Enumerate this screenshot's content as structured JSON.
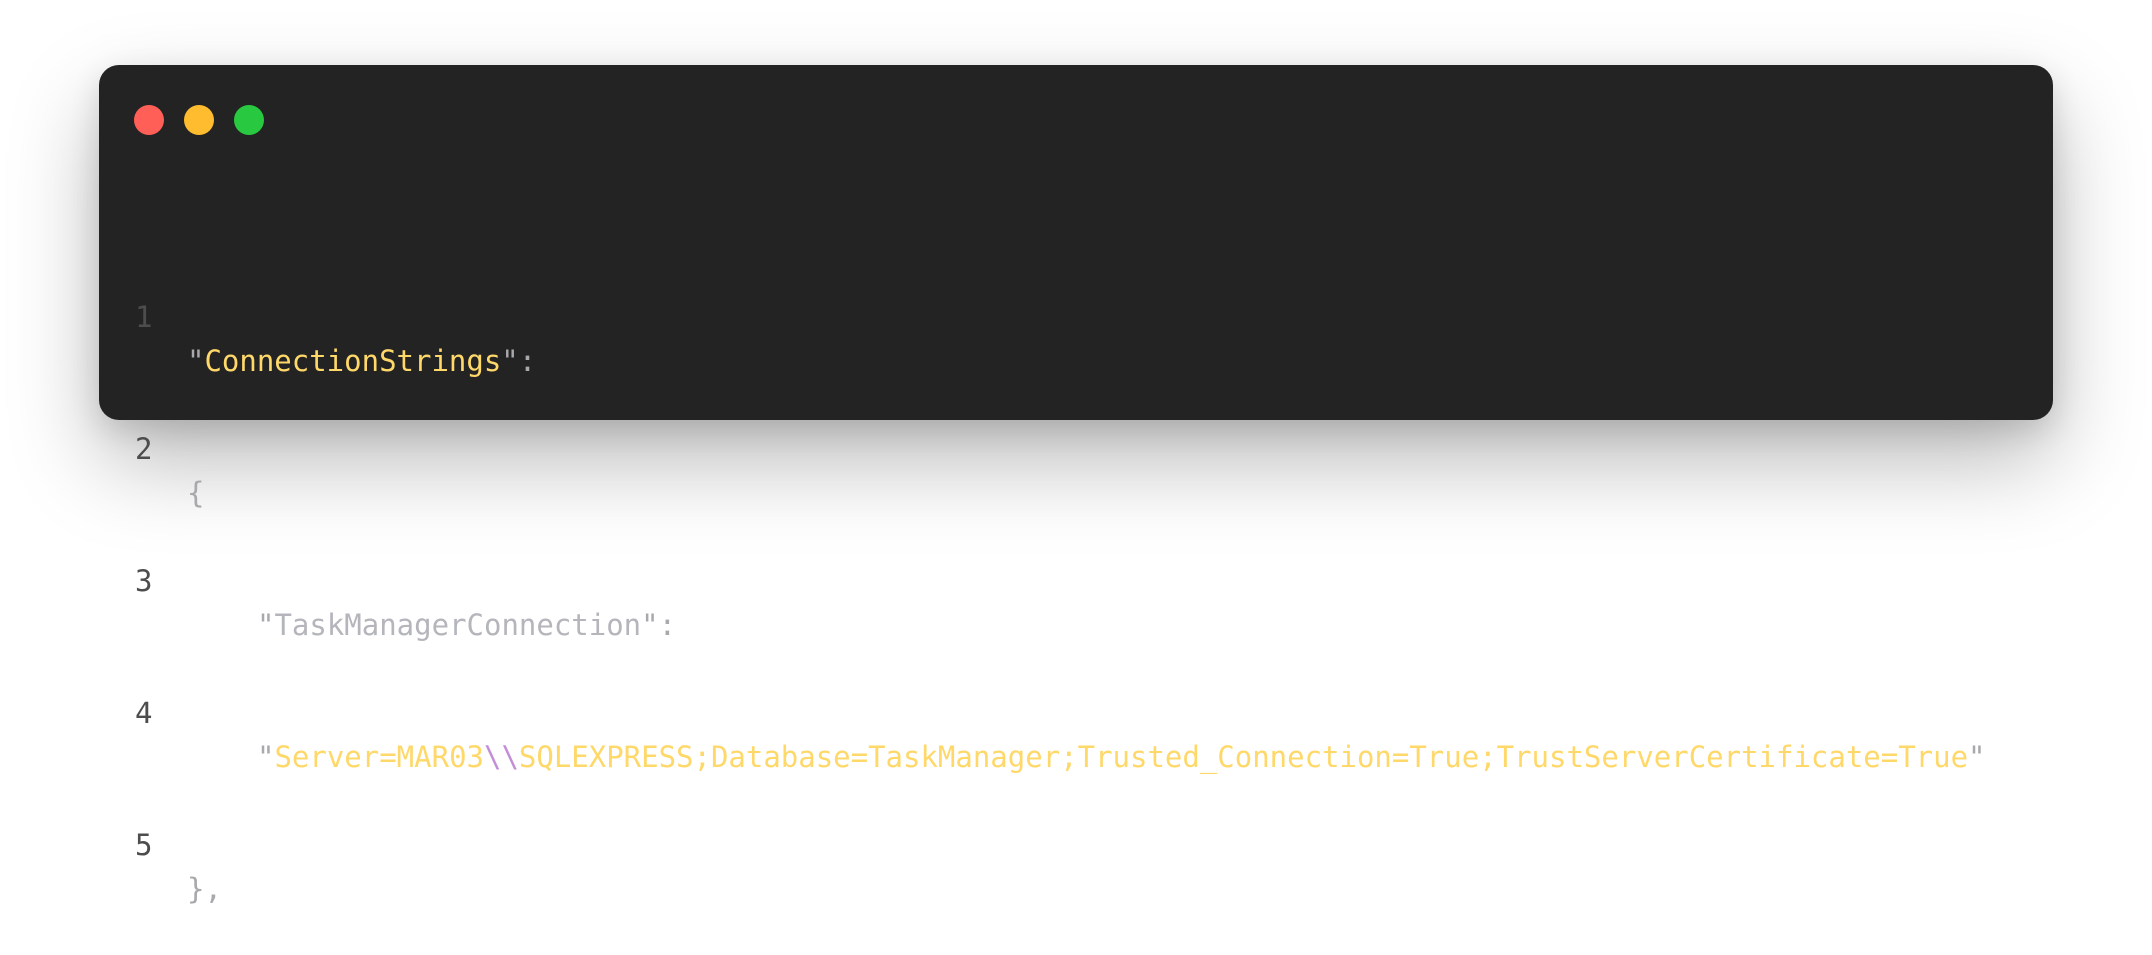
{
  "window_controls": {
    "close_color": "#ff5f57",
    "minimize_color": "#febc2e",
    "maximize_color": "#28c840"
  },
  "colors": {
    "background": "#232323",
    "string": "#ffd86a",
    "escape": "#c48ed6",
    "punctuation": "#a8a8ad",
    "line_number": "#4d4d4d"
  },
  "code": {
    "lines": [
      {
        "number": "1",
        "open_quote": "\"",
        "key": "ConnectionStrings",
        "close_quote": "\"",
        "suffix": ":"
      },
      {
        "number": "2",
        "text": "{"
      },
      {
        "number": "3",
        "open_quote": "\"",
        "key": "TaskManagerConnection",
        "close_quote": "\"",
        "suffix": ":"
      },
      {
        "number": "4",
        "open_quote": "\"",
        "value_part1": "Server=MAR03",
        "escape": "\\\\",
        "value_part2": "SQLEXPRESS;Database=TaskManager;Trusted_Connection=True;TrustServerCertificate=True",
        "close_quote": "\""
      },
      {
        "number": "5",
        "text": "},"
      }
    ]
  }
}
